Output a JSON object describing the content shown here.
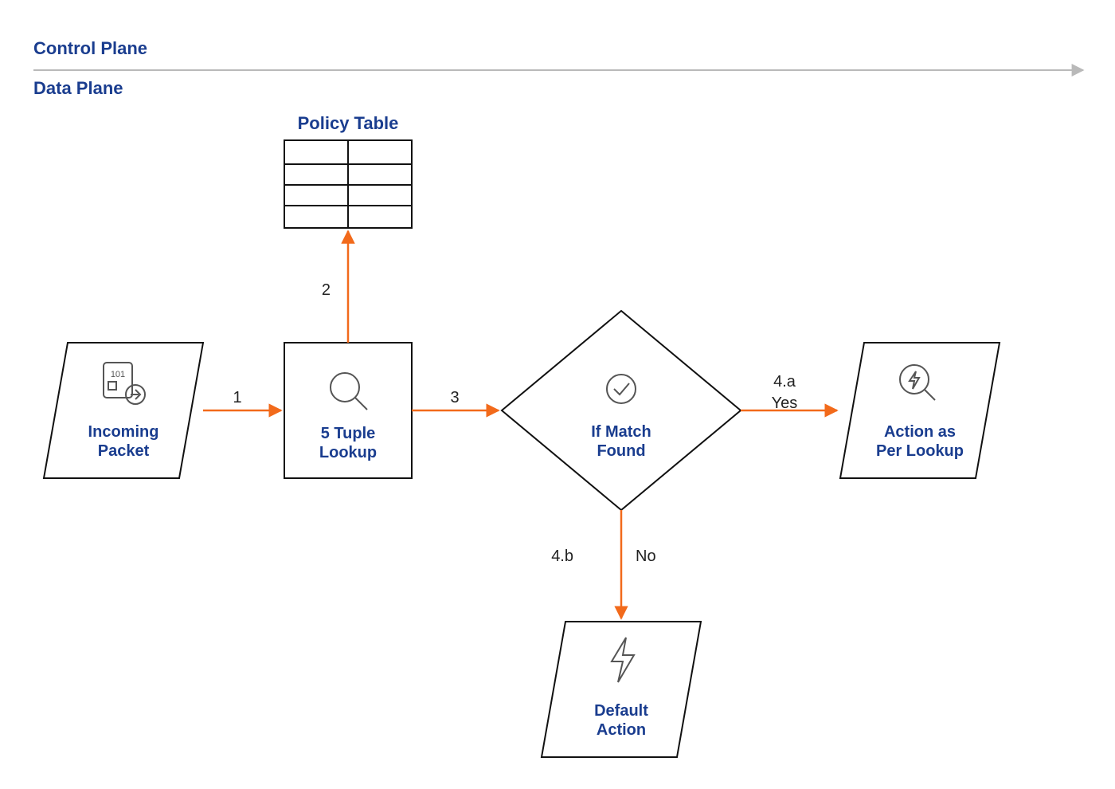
{
  "header": {
    "control_plane": "Control Plane",
    "data_plane": "Data Plane"
  },
  "nodes": {
    "policy_table": {
      "label": "Policy Table"
    },
    "incoming_packet": {
      "label_l1": "Incoming",
      "label_l2": "Packet"
    },
    "lookup": {
      "label_l1": "5 Tuple",
      "label_l2": "Lookup"
    },
    "decision": {
      "label_l1": "If Match",
      "label_l2": "Found"
    },
    "action_lookup": {
      "label_l1": "Action as",
      "label_l2": "Per Lookup"
    },
    "default_action": {
      "label_l1": "Default",
      "label_l2": "Action"
    }
  },
  "edges": {
    "e1": {
      "num": "1"
    },
    "e2": {
      "num": "2"
    },
    "e3": {
      "num": "3"
    },
    "e4a": {
      "num": "4.a",
      "branch": "Yes"
    },
    "e4b": {
      "num": "4.b",
      "branch": "No"
    }
  }
}
